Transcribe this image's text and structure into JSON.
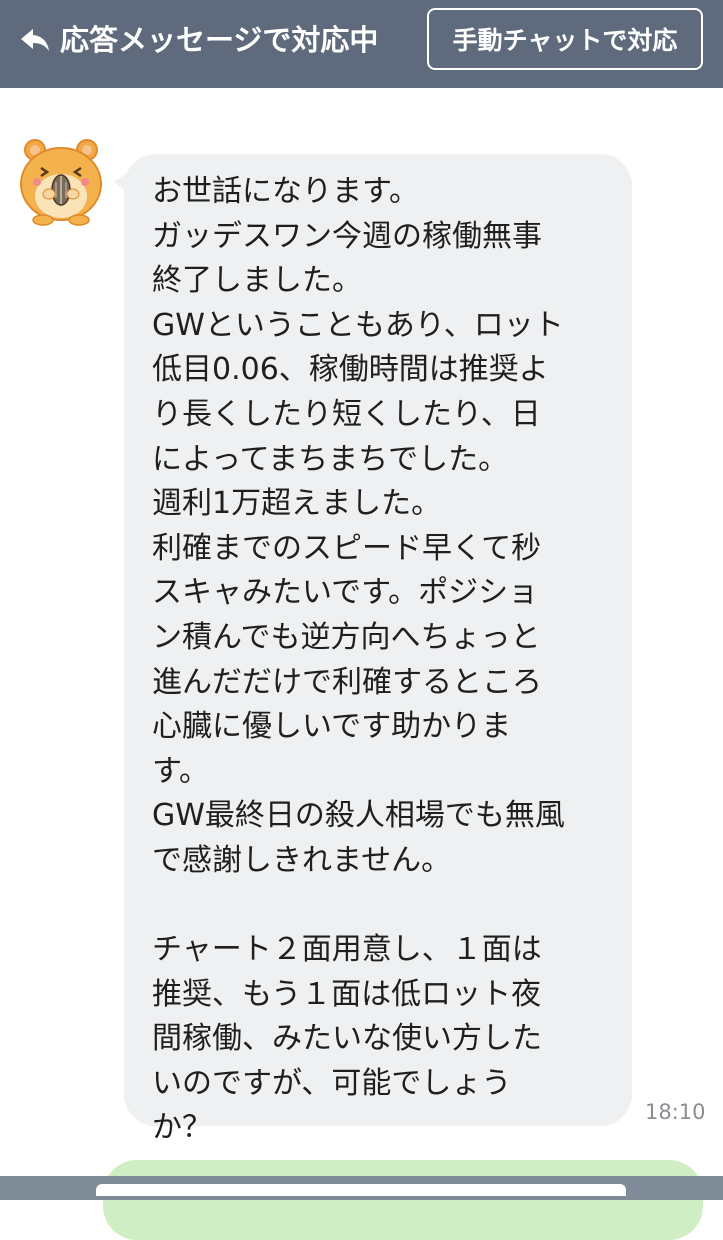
{
  "header": {
    "back_icon": "reply-arrow-icon",
    "title": "応答メッセージで対応中",
    "manual_button_label": "手動チャットで対応"
  },
  "message": {
    "avatar_icon": "hamster-avatar-icon",
    "text": "お世話になります。\nガッデスワン今週の稼働無事\n終了しました。\nGWということもあり、ロット\n低目0.06、稼働時間は推奨よ\nり長くしたり短くしたり、日\nによってまちまちでした。\n週利1万超えました。\n利確までのスピード早くて秒\nスキャみたいです。ポジショ\nン積んでも逆方向へちょっと\n進んだだけで利確するところ\n心臓に優しいです助かりま\nす。\nGW最終日の殺人相場でも無風\nで感謝しきれません。\n\nチャート２面用意し、１面は\n推奨、もう１面は低ロット夜\n間稼働、みたいな使い方した\nいのですが、可能でしょう\nか？",
    "time": "18:10"
  },
  "colors": {
    "header_bg": "#5f6b7c",
    "bubble_bg": "#eff0f1",
    "sent_bubble_bg": "#cfeec3"
  }
}
